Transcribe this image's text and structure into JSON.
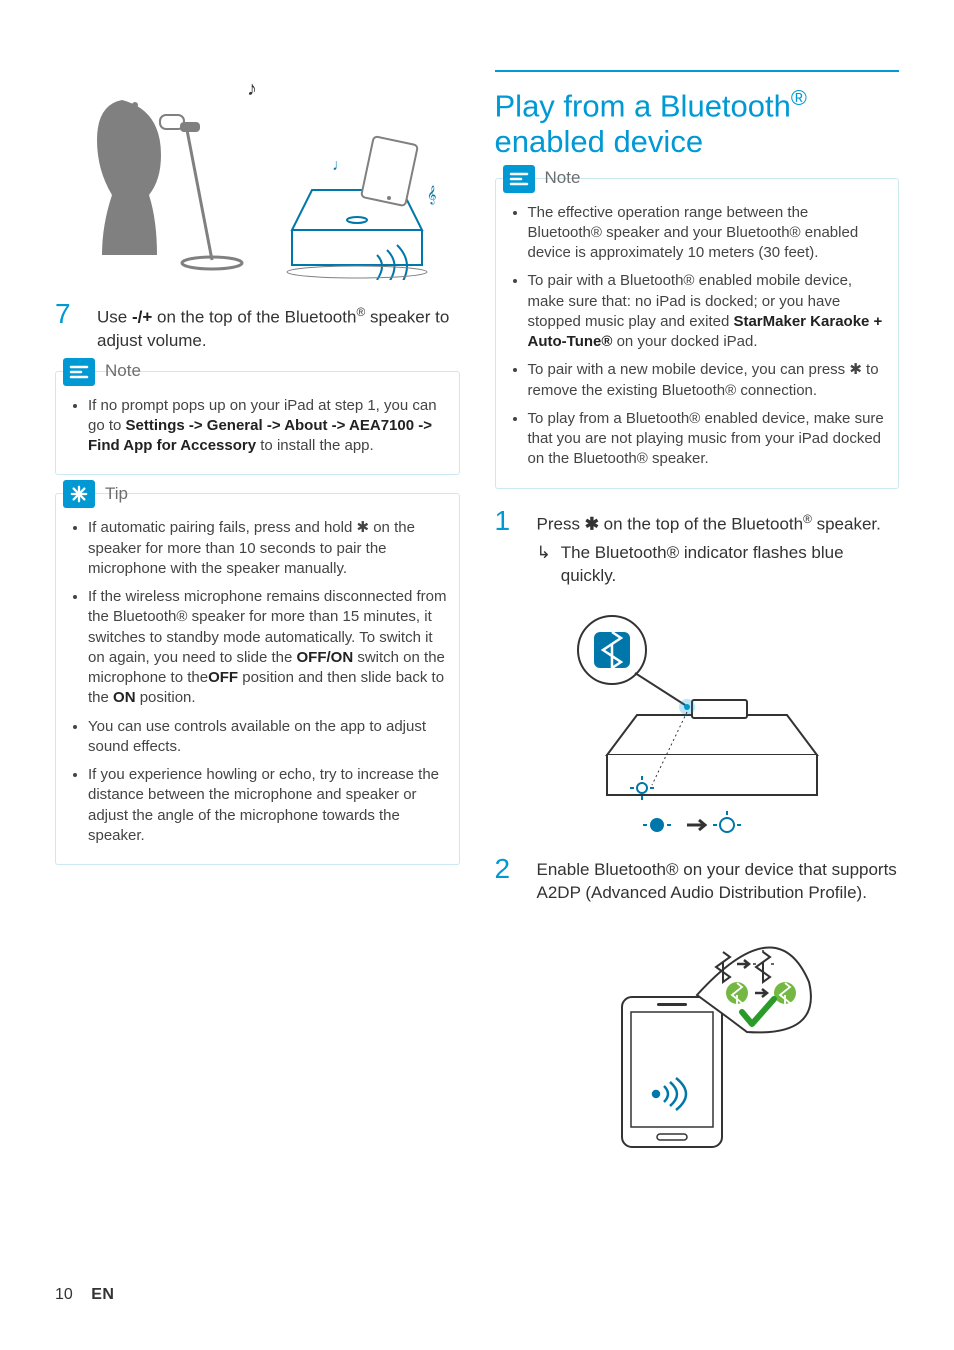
{
  "leftColumn": {
    "step7": {
      "num": "7",
      "text_pre": "Use ",
      "text_bold": "-/+",
      "text_post": " on the top of the Bluetooth",
      "text_tail": " speaker to adjust volume."
    },
    "note": {
      "title": "Note",
      "items": [
        {
          "pre": "If no prompt pops up on your iPad at step 1, you can go to ",
          "bold": "Settings -> General -> About -> AEA7100 -> Find App for Accessory",
          "post": " to install the app."
        }
      ]
    },
    "tip": {
      "title": "Tip",
      "items": [
        "If automatic pairing fails, press and hold ✱ on the speaker for more than 10 seconds to pair the microphone with the speaker manually.",
        {
          "pre": "If the wireless microphone remains disconnected from the Bluetooth® speaker for more than 15 minutes, it switches to standby mode automatically. To switch it on again, you need to slide the ",
          "b1": "OFF/ON",
          "mid1": " switch on the microphone to the",
          "b2": "OFF",
          "mid2": " position and then slide back to the ",
          "b3": "ON",
          "post": " position."
        },
        "You can use controls available on the app to adjust sound effects.",
        "If you experience howling or echo, try to increase the distance between the microphone and speaker or adjust the angle of the microphone towards the speaker."
      ]
    }
  },
  "rightColumn": {
    "heading_a": "Play from a Bluetooth",
    "heading_b": " enabled device",
    "note": {
      "title": "Note",
      "items": [
        "The effective operation range between the Bluetooth® speaker and your Bluetooth® enabled device is approximately 10 meters (30 feet).",
        {
          "pre": "To pair with a Bluetooth® enabled mobile device, make sure that: no iPad is docked; or you have stopped music play and exited ",
          "bold": "StarMaker Karaoke + Auto-Tune®",
          "post": " on your docked iPad."
        },
        "To pair with a new mobile device, you can press ✱ to remove the existing Bluetooth® connection.",
        "To play from a Bluetooth® enabled device, make sure that you are not playing music from your iPad docked on the Bluetooth® speaker."
      ]
    },
    "step1": {
      "num": "1",
      "text_a": "Press ",
      "text_b": " on the top of the Bluetooth",
      "text_c": " speaker.",
      "sub": "The Bluetooth® indicator flashes blue quickly."
    },
    "step2": {
      "num": "2",
      "text": "Enable Bluetooth® on your device that supports A2DP (Advanced Audio Distribution Profile)."
    }
  },
  "footer": {
    "page": "10",
    "lang": "EN"
  },
  "icons": {
    "note": "note-lines-icon",
    "tip": "asterisk-icon",
    "bt": "bluetooth-icon"
  }
}
